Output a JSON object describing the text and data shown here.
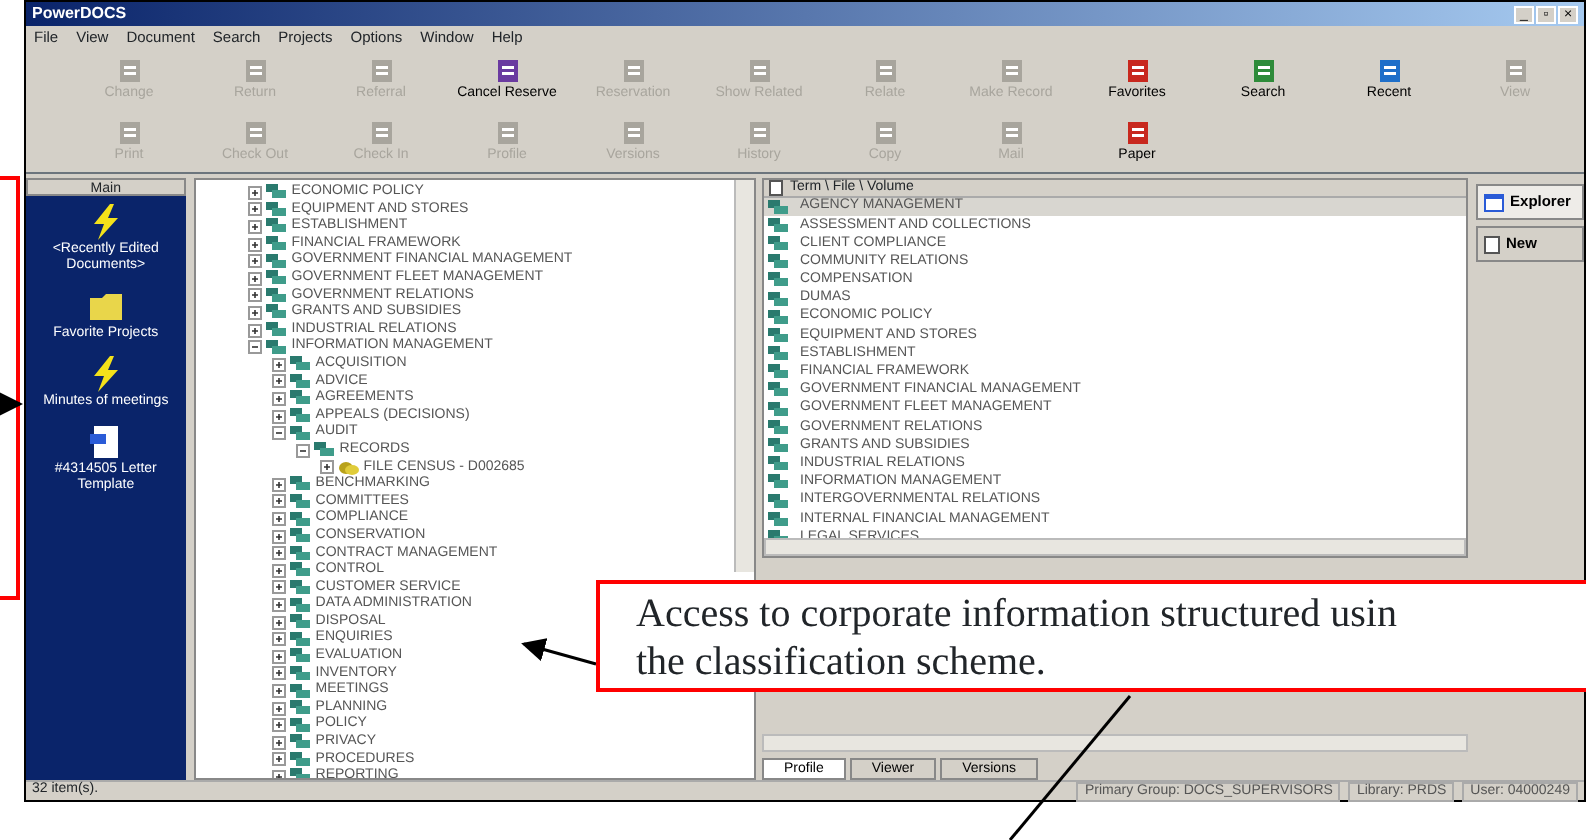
{
  "window": {
    "title": "PowerDOCS",
    "controls": [
      "_",
      "▫",
      "×"
    ]
  },
  "menu": [
    "File",
    "View",
    "Document",
    "Search",
    "Projects",
    "Options",
    "Window",
    "Help"
  ],
  "toolbar": [
    [
      {
        "label": "Change",
        "disabled": true
      },
      {
        "label": "Return",
        "disabled": true
      },
      {
        "label": "Referral",
        "disabled": true
      },
      {
        "label": "Cancel Reserve",
        "disabled": false
      },
      {
        "label": "Reservation",
        "disabled": true
      },
      {
        "label": "Show Related",
        "disabled": true
      },
      {
        "label": "Relate",
        "disabled": true
      },
      {
        "label": "Make Record",
        "disabled": true
      },
      {
        "label": "Favorites",
        "disabled": false
      },
      {
        "label": "Search",
        "disabled": false
      },
      {
        "label": "Recent",
        "disabled": false
      },
      {
        "label": "View",
        "disabled": true
      }
    ],
    [
      {
        "label": "Print",
        "disabled": true
      },
      {
        "label": "Check Out",
        "disabled": true
      },
      {
        "label": "Check In",
        "disabled": true
      },
      {
        "label": "Profile",
        "disabled": true
      },
      {
        "label": "Versions",
        "disabled": true
      },
      {
        "label": "History",
        "disabled": true
      },
      {
        "label": "Copy",
        "disabled": true
      },
      {
        "label": "Mail",
        "disabled": true
      },
      {
        "label": "Paper",
        "disabled": false
      }
    ]
  ],
  "sidebar": {
    "title": "Main",
    "items": [
      {
        "label": "<Recently Edited Documents>",
        "kind": "bolt"
      },
      {
        "label": "Favorite Projects",
        "kind": "folder"
      },
      {
        "label": "Minutes of meetings",
        "kind": "bolt"
      },
      {
        "label": "#4314505 Letter Template",
        "kind": "document"
      }
    ]
  },
  "tree": [
    {
      "label": "ECONOMIC POLICY",
      "expanded": false
    },
    {
      "label": "EQUIPMENT AND STORES",
      "expanded": false
    },
    {
      "label": "ESTABLISHMENT",
      "expanded": false
    },
    {
      "label": "FINANCIAL FRAMEWORK",
      "expanded": false
    },
    {
      "label": "GOVERNMENT FINANCIAL MANAGEMENT",
      "expanded": false
    },
    {
      "label": "GOVERNMENT FLEET MANAGEMENT",
      "expanded": false
    },
    {
      "label": "GOVERNMENT RELATIONS",
      "expanded": false
    },
    {
      "label": "GRANTS AND SUBSIDIES",
      "expanded": false
    },
    {
      "label": "INDUSTRIAL RELATIONS",
      "expanded": false
    },
    {
      "label": "INFORMATION MANAGEMENT",
      "expanded": true,
      "children": [
        {
          "label": "ACQUISITION",
          "expanded": false
        },
        {
          "label": "ADVICE",
          "expanded": false
        },
        {
          "label": "AGREEMENTS",
          "expanded": false
        },
        {
          "label": "APPEALS (DECISIONS)",
          "expanded": false
        },
        {
          "label": "AUDIT",
          "expanded": true,
          "children": [
            {
              "label": "RECORDS",
              "expanded": true,
              "children": [
                {
                  "label": "FILE CENSUS - D002685",
                  "expanded": false,
                  "kind": "file"
                }
              ]
            }
          ]
        },
        {
          "label": "BENCHMARKING",
          "expanded": false
        },
        {
          "label": "COMMITTEES",
          "expanded": false
        },
        {
          "label": "COMPLIANCE",
          "expanded": false
        },
        {
          "label": "CONSERVATION",
          "expanded": false
        },
        {
          "label": "CONTRACT MANAGEMENT",
          "expanded": false
        },
        {
          "label": "CONTROL",
          "expanded": false
        },
        {
          "label": "CUSTOMER SERVICE",
          "expanded": false
        },
        {
          "label": "DATA ADMINISTRATION",
          "expanded": false
        },
        {
          "label": "DISPOSAL",
          "expanded": false
        },
        {
          "label": "ENQUIRIES",
          "expanded": false
        },
        {
          "label": "EVALUATION",
          "expanded": false
        },
        {
          "label": "INVENTORY",
          "expanded": false
        },
        {
          "label": "MEETINGS",
          "expanded": false
        },
        {
          "label": "PLANNING",
          "expanded": false
        },
        {
          "label": "POLICY",
          "expanded": false
        },
        {
          "label": "PRIVACY",
          "expanded": false
        },
        {
          "label": "PROCEDURES",
          "expanded": false
        },
        {
          "label": "REPORTING",
          "expanded": false
        }
      ]
    }
  ],
  "list": {
    "header": "Term \\ File \\ Volume",
    "rows": [
      {
        "label": "AGENCY MANAGEMENT",
        "selected": true
      },
      {
        "label": "ASSESSMENT AND COLLECTIONS",
        "selected": false
      },
      {
        "label": "CLIENT COMPLIANCE",
        "selected": false
      },
      {
        "label": "COMMUNITY RELATIONS",
        "selected": false
      },
      {
        "label": "COMPENSATION",
        "selected": false
      },
      {
        "label": "DUMAS",
        "selected": false
      },
      {
        "label": "ECONOMIC POLICY",
        "selected": false
      },
      {
        "label": "EQUIPMENT AND STORES",
        "selected": false
      },
      {
        "label": "ESTABLISHMENT",
        "selected": false
      },
      {
        "label": "FINANCIAL FRAMEWORK",
        "selected": false
      },
      {
        "label": "GOVERNMENT FINANCIAL MANAGEMENT",
        "selected": false
      },
      {
        "label": "GOVERNMENT FLEET MANAGEMENT",
        "selected": false
      },
      {
        "label": "GOVERNMENT RELATIONS",
        "selected": false
      },
      {
        "label": "GRANTS AND SUBSIDIES",
        "selected": false
      },
      {
        "label": "INDUSTRIAL RELATIONS",
        "selected": false
      },
      {
        "label": "INFORMATION MANAGEMENT",
        "selected": false
      },
      {
        "label": "INTERGOVERNMENTAL RELATIONS",
        "selected": false
      },
      {
        "label": "INTERNAL FINANCIAL MANAGEMENT",
        "selected": false
      },
      {
        "label": "LEGAL SERVICES",
        "selected": false
      }
    ]
  },
  "bottom_tabs": [
    {
      "label": "Profile",
      "selected": true
    },
    {
      "label": "Viewer",
      "selected": false
    },
    {
      "label": "Versions",
      "selected": false
    }
  ],
  "side_tabs": [
    {
      "label": "Explorer",
      "selected": true
    },
    {
      "label": "New",
      "selected": false
    }
  ],
  "status_bar": [
    "32 item(s).",
    "Primary Group: DOCS_SUPERVISORS",
    "Library: PRDS",
    "User: 04000249"
  ],
  "callout": {
    "lines": [
      "Access to corporate information structured usin",
      "the classification scheme."
    ]
  }
}
